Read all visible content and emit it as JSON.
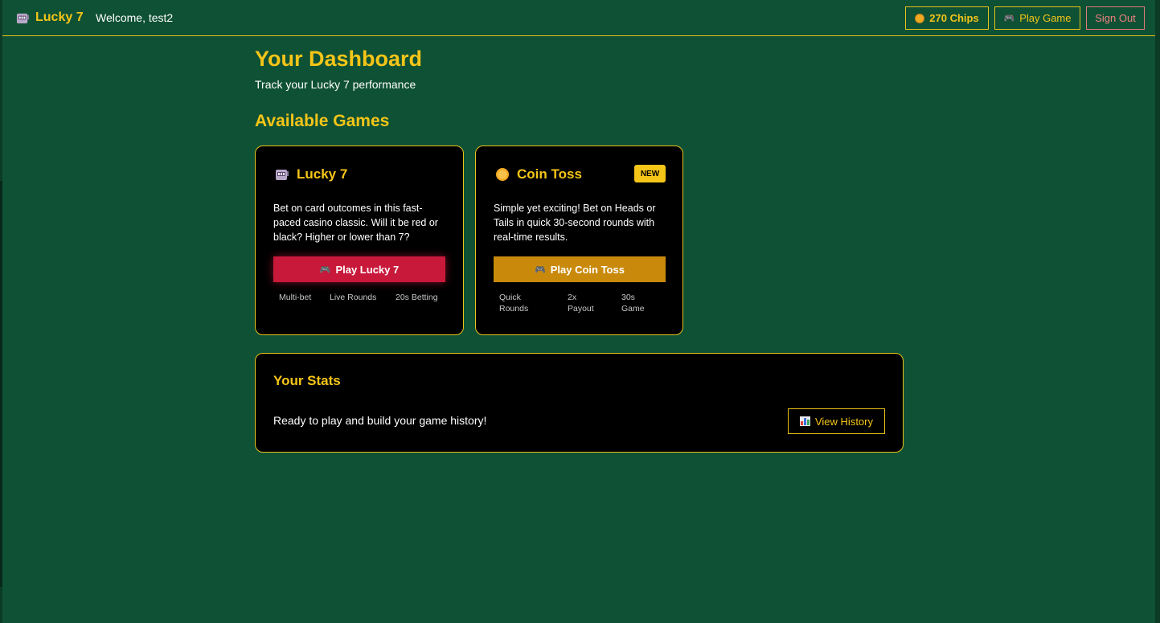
{
  "header": {
    "brand": "Lucky 7",
    "welcome": "Welcome, test2",
    "chips": "270 Chips",
    "play_game": "Play Game",
    "sign_out": "Sign Out"
  },
  "dashboard": {
    "title": "Your Dashboard",
    "subtitle": "Track your Lucky 7 performance"
  },
  "games": {
    "title": "Available Games",
    "items": [
      {
        "icon": "slot-machine-icon",
        "name": "Lucky 7",
        "description": "Bet on card outcomes in this fast-paced casino classic. Will it be red or black? Higher or lower than 7?",
        "play_label": "Play Lucky 7",
        "features": [
          "Multi-bet",
          "Live Rounds",
          "20s Betting"
        ],
        "color": "#c8193a"
      },
      {
        "icon": "coin-icon",
        "name": "Coin Toss",
        "badge": "NEW",
        "description": "Simple yet exciting! Bet on Heads or Tails in quick 30-second rounds with real-time results.",
        "play_label": "Play Coin Toss",
        "features": [
          "Quick Rounds",
          "2x Payout",
          "30s Game"
        ],
        "color": "#c98a0c"
      }
    ]
  },
  "stats": {
    "title": "Your Stats",
    "message": "Ready to play and build your game history!",
    "history_label": "View History"
  },
  "colors": {
    "background": "#0f5135",
    "accent": "#f5c518",
    "danger": "#ee8080"
  }
}
